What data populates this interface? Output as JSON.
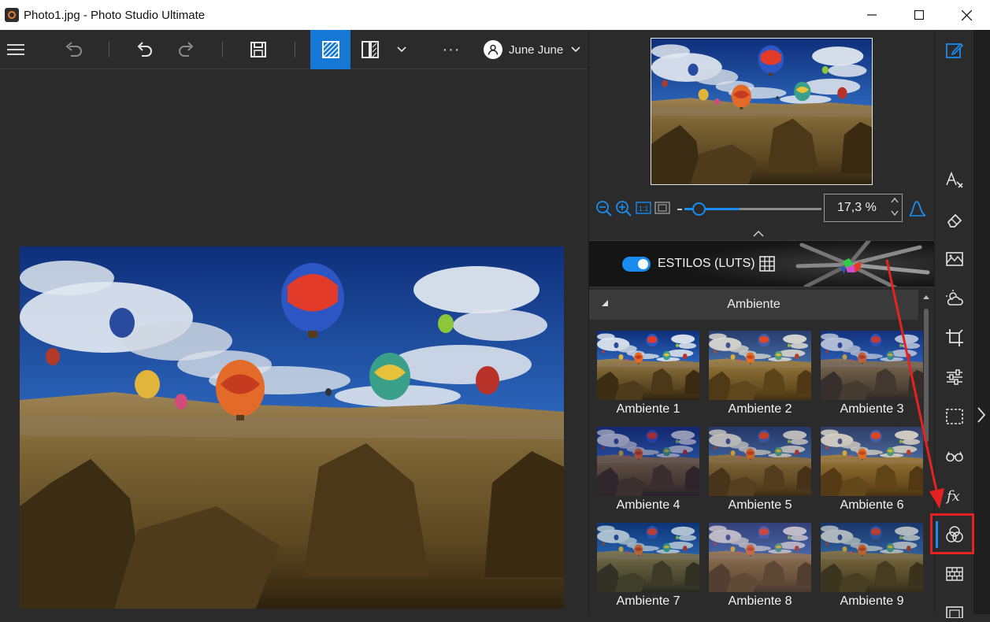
{
  "window": {
    "title": "Photo1.jpg - Photo Studio Ultimate",
    "minimize": "—",
    "maximize": "☐",
    "close": "✕"
  },
  "toolbar": {
    "menu_icon": "hamburger-icon",
    "items": [
      "undo-all-icon",
      "undo-icon",
      "redo-icon",
      "save-icon",
      "compare-icon",
      "split-view-icon",
      "more-icon"
    ],
    "more_label": "···",
    "user_name": "June June",
    "active_color": "#1478d4"
  },
  "right_panel": {
    "zoom_value": "17,3 %",
    "styles_label": "ESTILOS (LUTS)",
    "styles_enabled": true,
    "category": "Ambiente",
    "thumbnails": [
      {
        "label": "Ambiente 1"
      },
      {
        "label": "Ambiente 2"
      },
      {
        "label": "Ambiente 3"
      },
      {
        "label": "Ambiente 4"
      },
      {
        "label": "Ambiente 5"
      },
      {
        "label": "Ambiente 6"
      },
      {
        "label": "Ambiente 7"
      },
      {
        "label": "Ambiente 8"
      },
      {
        "label": "Ambiente 9"
      }
    ],
    "accent_color": "#1a8cf0"
  },
  "side_toolbar": {
    "icons": [
      "edit-icon",
      "text-style-icon",
      "eraser-icon",
      "landscape-icon",
      "weather-icon",
      "crop-icon",
      "adjustments-icon",
      "selection-icon",
      "glasses-icon",
      "fx-icon",
      "color-circles-icon",
      "texture-icon",
      "frame-icon"
    ],
    "active": "color-circles-icon",
    "highlight_color": "#e52222"
  }
}
